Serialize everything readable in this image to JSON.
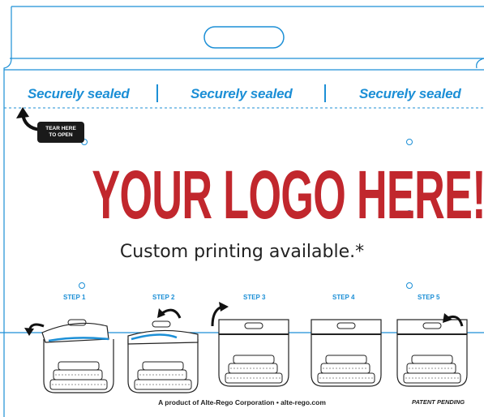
{
  "header": {
    "sealed_labels": [
      "Securely sealed",
      "Securely sealed",
      "Securely sealed"
    ]
  },
  "tear": {
    "line1": "TEAR HERE",
    "line2": "TO OPEN"
  },
  "main": {
    "logo_text": "YOUR LOGO HERE!",
    "custom_text": "Custom printing available.*"
  },
  "steps": [
    {
      "label": "STEP 1"
    },
    {
      "label": "STEP 2"
    },
    {
      "label": "STEP 3"
    },
    {
      "label": "STEP 4"
    },
    {
      "label": "STEP 5"
    }
  ],
  "footer": {
    "product_text": "A product of Alte-Rego Corporation  •  alte-rego.com",
    "patent_text": "PATENT PENDING"
  },
  "colors": {
    "accent_blue": "#1c8fd6",
    "logo_red": "#c1272d",
    "tag_black": "#1a1a1a"
  },
  "icons": [
    "curved-arrow-icon",
    "bag-step-icon"
  ]
}
